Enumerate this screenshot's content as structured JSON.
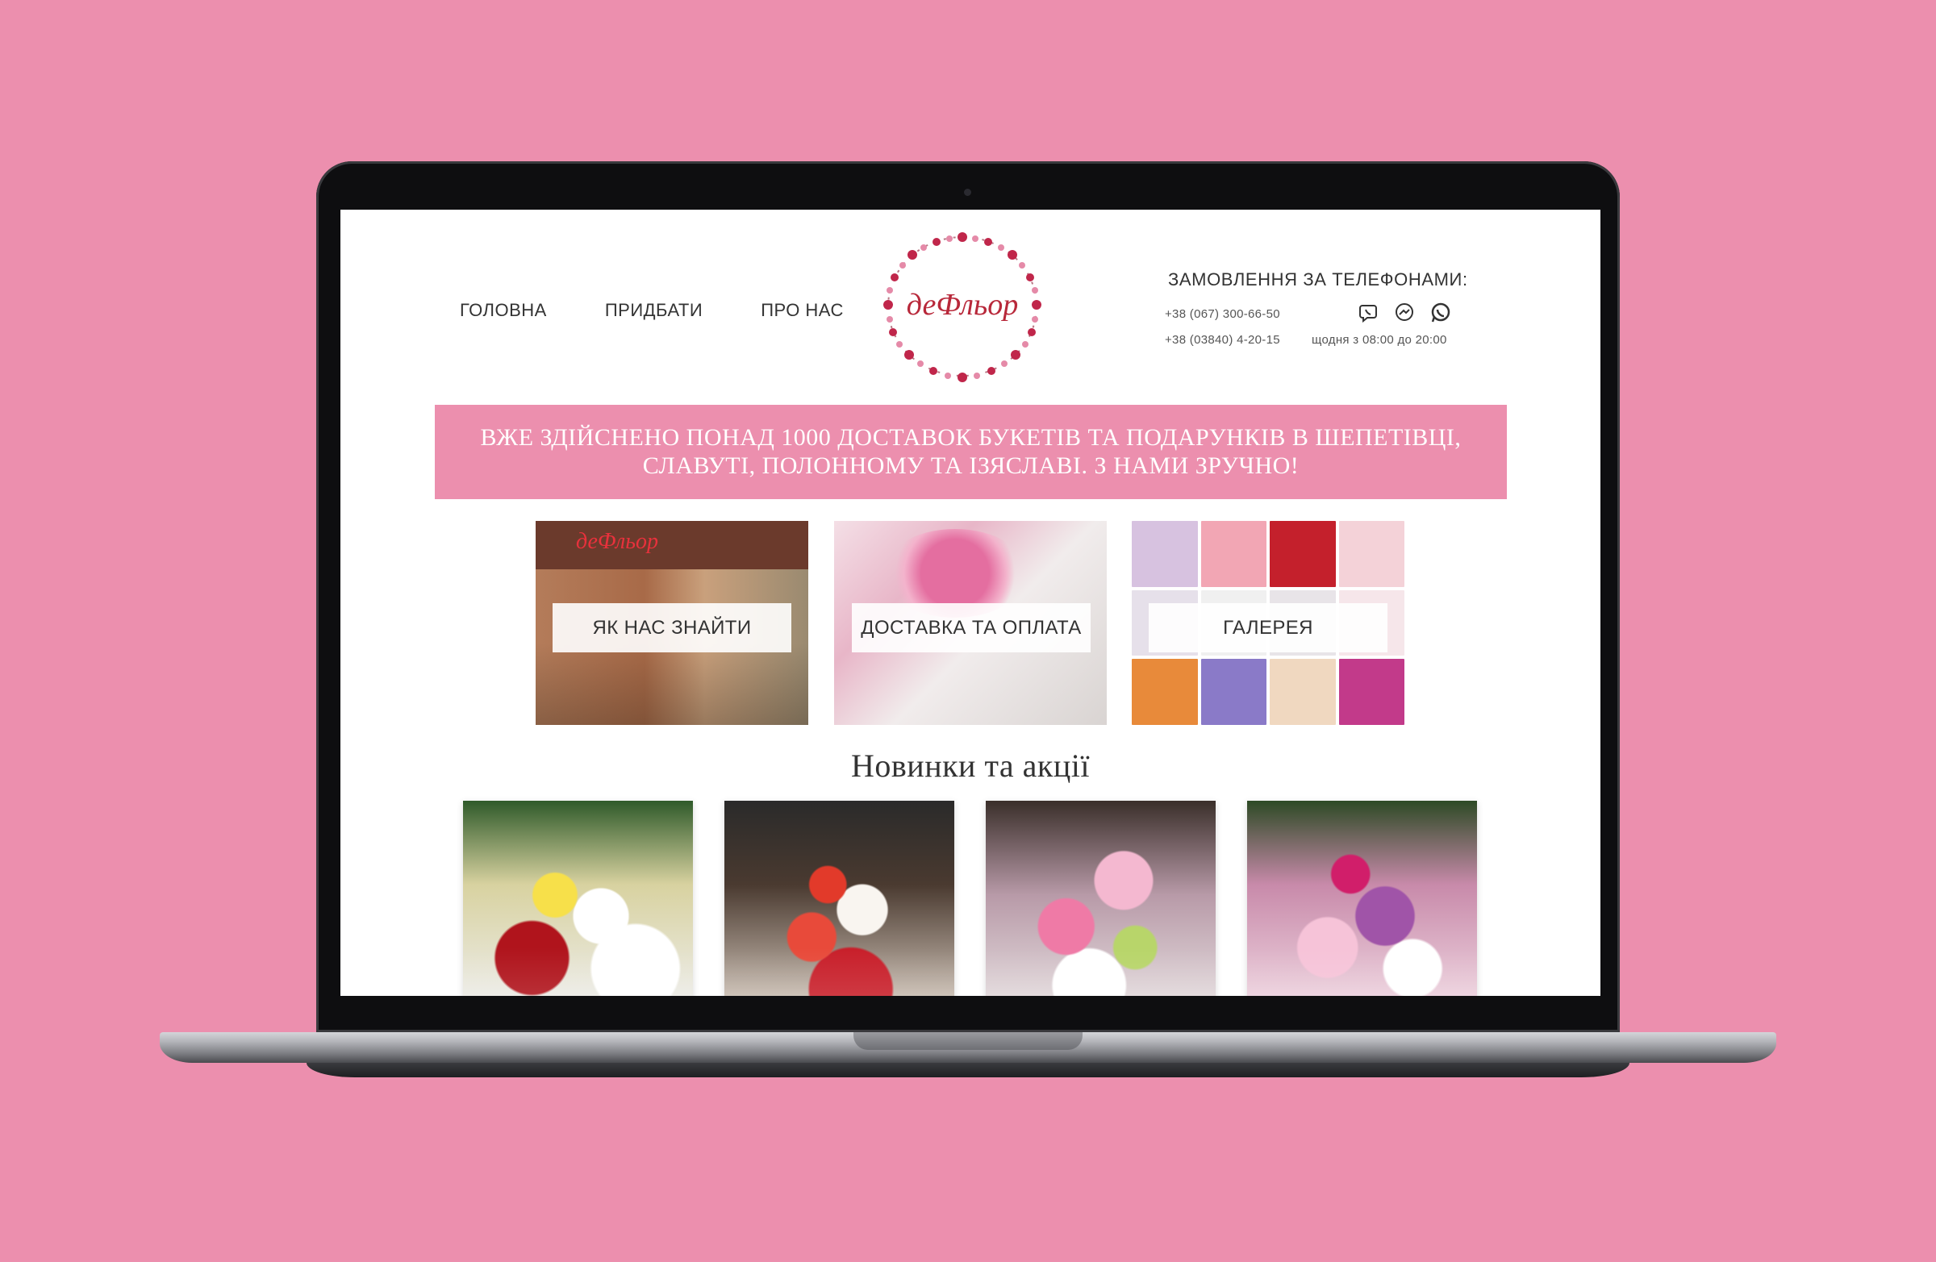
{
  "nav": {
    "items": [
      "ГОЛОВНА",
      "ПРИДБАТИ",
      "ПРО НАС"
    ]
  },
  "logo": {
    "text": "деФльор"
  },
  "contacts": {
    "title": "ЗАМОВЛЕННЯ ЗА ТЕЛЕФОНАМИ:",
    "phone1": "+38 (067) 300-66-50",
    "phone2": "+38 (03840) 4-20-15",
    "hours": "щодня з 08:00 до 20:00",
    "icons": [
      "viber-icon",
      "messenger-icon",
      "whatsapp-icon"
    ]
  },
  "banner": {
    "line1": "ВЖЕ ЗДІЙСНЕНО ПОНАД 1000 ДОСТАВОК БУКЕТІВ ТА ПОДАРУНКІВ В ШЕПЕТІВЦІ,",
    "line2": "СЛАВУТІ, ПОЛОННОМУ ТА ІЗЯСЛАВІ. З НАМИ ЗРУЧНО!"
  },
  "tiles": [
    {
      "label": "ЯК НАС ЗНАЙТИ"
    },
    {
      "label": "ДОСТАВКА ТА ОПЛАТА"
    },
    {
      "label": "ГАЛЕРЕЯ"
    }
  ],
  "section": {
    "title": "Новинки та акції"
  },
  "colors": {
    "background": "#ec8fae",
    "accent": "#ec8fae",
    "logo_red": "#b8283a"
  }
}
